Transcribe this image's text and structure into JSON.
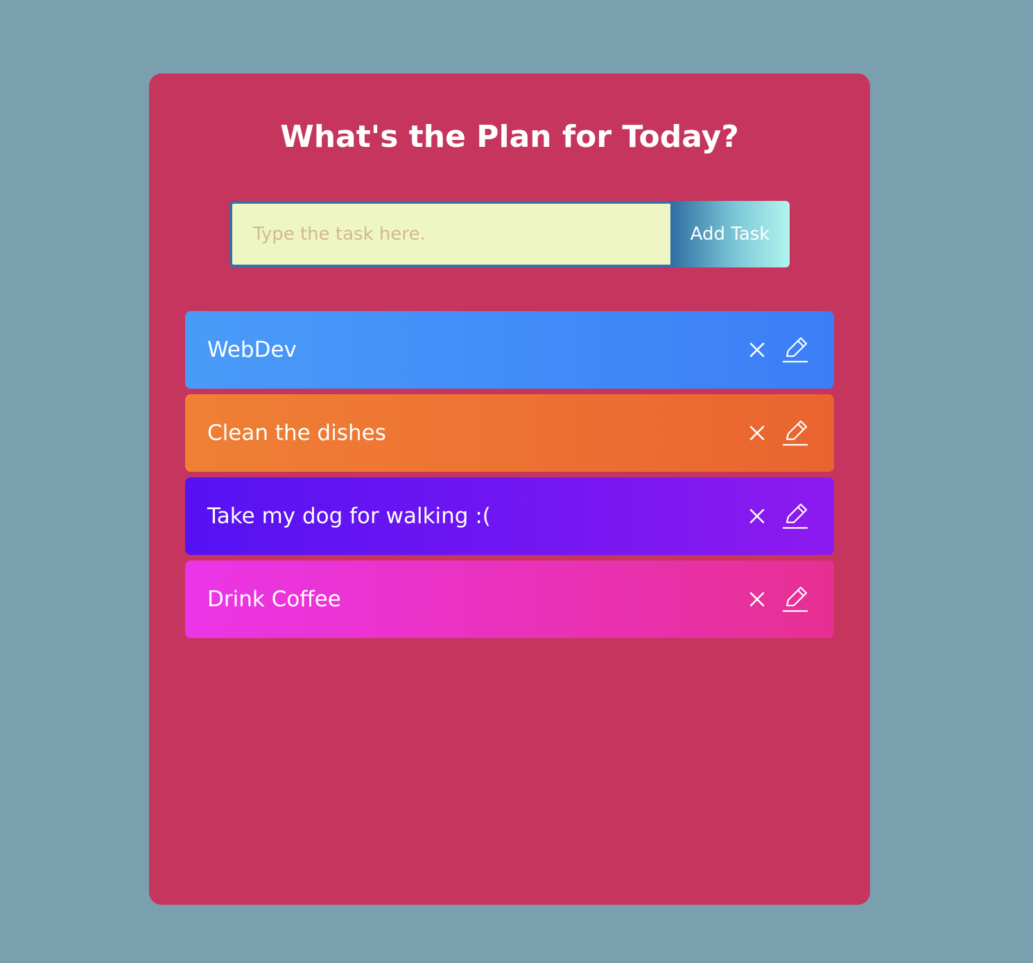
{
  "header": {
    "title": "What's the Plan for Today?"
  },
  "form": {
    "input_placeholder": "Type the task here.",
    "input_value": "",
    "add_button_label": "Add Task"
  },
  "todos": [
    {
      "text": "WebDev",
      "delete_icon": "close-icon",
      "edit_icon": "pencil-icon"
    },
    {
      "text": "Clean the dishes",
      "delete_icon": "close-icon",
      "edit_icon": "pencil-icon"
    },
    {
      "text": "Take my dog for walking :(",
      "delete_icon": "close-icon",
      "edit_icon": "pencil-icon"
    },
    {
      "text": "Drink Coffee",
      "delete_icon": "close-icon",
      "edit_icon": "pencil-icon"
    }
  ],
  "colors": {
    "page_background": "#7aa0b0",
    "card_background": "#c5355d",
    "todo_gradients": [
      [
        "#4a9bf8",
        "#3b7ef7"
      ],
      [
        "#ef8035",
        "#ea6430"
      ],
      [
        "#5512f3",
        "#8c1af0"
      ],
      [
        "#ec35e8",
        "#e72f92"
      ]
    ]
  }
}
